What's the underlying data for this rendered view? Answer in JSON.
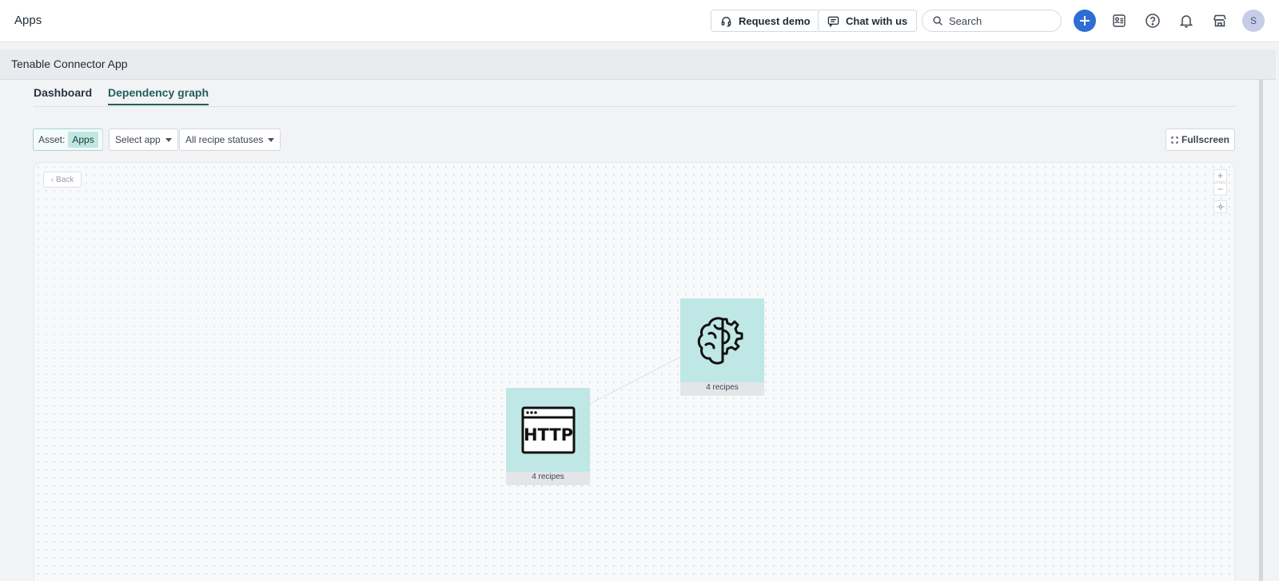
{
  "header": {
    "title": "Apps",
    "request_demo": "Request demo",
    "chat": "Chat with us",
    "search_placeholder": "Search",
    "avatar_initial": "S"
  },
  "subheader": {
    "title": "Tenable Connector App"
  },
  "tabs": [
    {
      "label": "Dashboard",
      "active": false
    },
    {
      "label": "Dependency graph",
      "active": true
    }
  ],
  "filters": {
    "asset_label": "Asset:",
    "asset_value": "Apps",
    "select_app": "Select app",
    "recipe_status": "All recipe statuses",
    "fullscreen": "Fullscreen"
  },
  "graph": {
    "back": "Back",
    "zoom_in": "+",
    "zoom_out": "−",
    "nodes": [
      {
        "icon": "brain-gear-icon",
        "caption": "4 recipes"
      },
      {
        "icon": "http-browser-icon",
        "label": "HTTP",
        "caption": "4 recipes"
      }
    ]
  },
  "colors": {
    "accent": "#2c6ed5",
    "active_tab": "#1f5f5b",
    "node_fill": "#bfe7e6"
  }
}
